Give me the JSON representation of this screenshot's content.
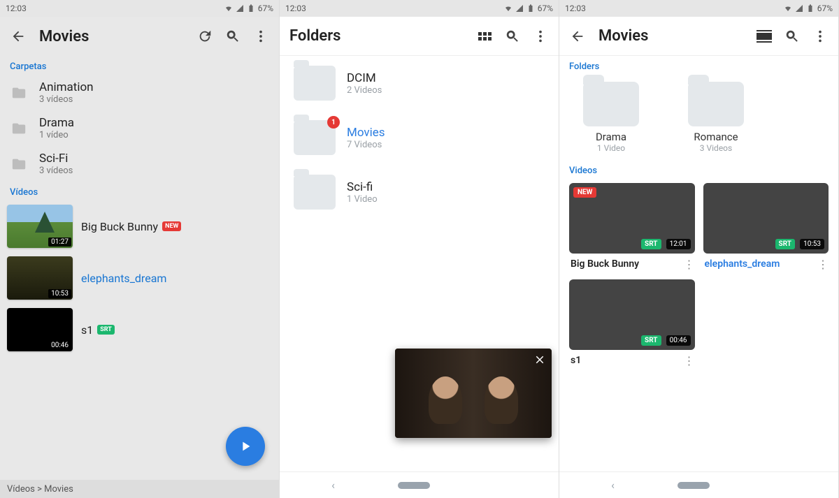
{
  "status": {
    "time": "12:03",
    "battery": "67%"
  },
  "screen1": {
    "title": "Movies",
    "section_folders": "Carpetas",
    "section_videos": "Vídeos",
    "folders": [
      {
        "name": "Animation",
        "count": "3 vídeos"
      },
      {
        "name": "Drama",
        "count": "1 vídeo"
      },
      {
        "name": "Sci-Fi",
        "count": "3 vídeos"
      }
    ],
    "videos": [
      {
        "name": "Big Buck Bunny",
        "dur": "01:27",
        "new": true,
        "srt": false,
        "link": false
      },
      {
        "name": "elephants_dream",
        "dur": "10:53",
        "new": false,
        "srt": false,
        "link": true
      },
      {
        "name": "s1",
        "dur": "00:46",
        "new": false,
        "srt": true,
        "link": false
      }
    ],
    "breadcrumb": "Vídeos > Movies",
    "new_label": "NEW",
    "srt_label": "SRT"
  },
  "screen2": {
    "title": "Folders",
    "folders": [
      {
        "name": "DCIM",
        "count": "2 Videos",
        "badge": null,
        "blue": false
      },
      {
        "name": "Movies",
        "count": "7 Videos",
        "badge": "1",
        "blue": true
      },
      {
        "name": "Sci-fi",
        "count": "1 Video",
        "badge": null,
        "blue": false
      }
    ]
  },
  "screen3": {
    "title": "Movies",
    "section_folders": "Folders",
    "section_videos": "Videos",
    "folders": [
      {
        "name": "Drama",
        "count": "1 Video"
      },
      {
        "name": "Romance",
        "count": "3 Videos"
      }
    ],
    "videos": [
      {
        "name": "Big Buck Bunny",
        "dur": "12:01",
        "new": true,
        "srt": true,
        "blue": false
      },
      {
        "name": "elephants_dream",
        "dur": "10:53",
        "new": false,
        "srt": true,
        "blue": true
      },
      {
        "name": "s1",
        "dur": "00:46",
        "new": false,
        "srt": true,
        "blue": false
      }
    ],
    "new_label": "NEW",
    "srt_label": "SRT"
  }
}
